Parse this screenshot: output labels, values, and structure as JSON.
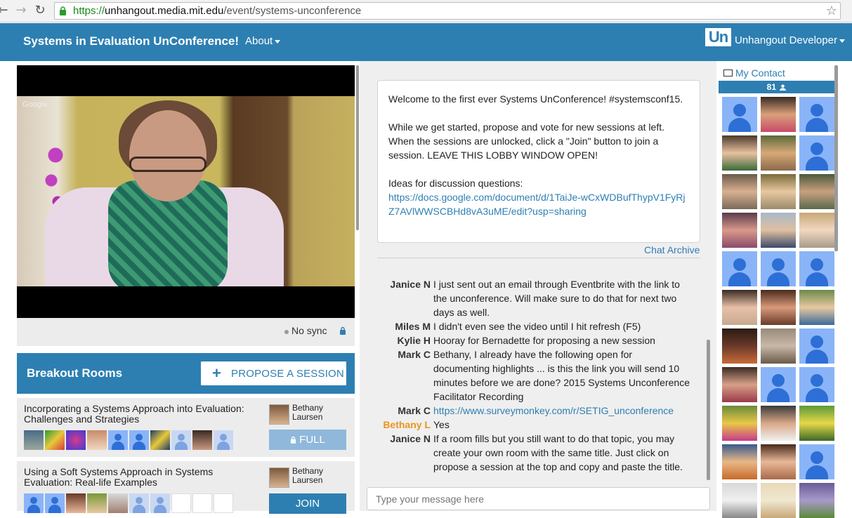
{
  "browser": {
    "url_scheme": "https://",
    "url_host": "unhangout.media.mit.edu",
    "url_path": "/event/systems-unconference"
  },
  "header": {
    "title": "Systems in Evaluation UnConference!",
    "about_label": "About",
    "logo_text": "Un",
    "user_label": "Unhangout Developer"
  },
  "video": {
    "watermark": "Google",
    "sync_label": "No sync"
  },
  "breakout": {
    "title": "Breakout Rooms",
    "propose_label": "PROPOSE A SESSION",
    "sessions": [
      {
        "title": "Incorporating a Systems Approach into Evaluation: Challenges and Strategies",
        "host": "Bethany Laursen",
        "button_label": "FULL"
      },
      {
        "title": "Using a Soft Systems Approach in Systems Evaluation: Real-life Examples",
        "host": "Bethany Laursen",
        "button_label": "JOIN"
      }
    ]
  },
  "welcome": {
    "line1": "Welcome to the first ever Systems UnConference! #systemsconf15.",
    "line2": "While we get started, propose and vote for new sessions at left. When the sessions are unlocked, click a \"Join\" button to join a session. LEAVE THIS LOBBY WINDOW OPEN!",
    "line3": "Ideas for discussion questions:",
    "link": "https://docs.google.com/document/d/1TaiJe-wCxWDBufThypV1FyRjZ7AVlWWSCBHd8vA3uME/edit?usp=sharing"
  },
  "chat": {
    "archive_label": "Chat Archive",
    "input_placeholder": "Type your message here",
    "messages": [
      {
        "who": "Janice N",
        "text": "I just sent out an email through Eventbrite with the link to the unconference. Will make sure to do that for next two days as well."
      },
      {
        "who": "Miles M",
        "text": "I didn't even see the video until I hit refresh (F5)"
      },
      {
        "who": "Kylie H",
        "text": "Hooray for Bernadette for proposing a new session"
      },
      {
        "who": "Mark C",
        "text": "Bethany, I already have the following open for documenting highlights ... is this the link you will send 10 minutes before we are done? 2015 Systems Unconference Facilitator Recording"
      },
      {
        "who": "Mark C",
        "text": "https://www.surveymonkey.com/r/SETIG_unconference"
      },
      {
        "who": "Bethany L",
        "text": "Yes"
      },
      {
        "who": "Janice N",
        "text": "If a room fills but you still want to do that topic, you may create your own room with the same title. Just click on propose a session at the top and copy and paste the title."
      }
    ]
  },
  "sidebar": {
    "contact_label": "My Contact",
    "participant_count": "81"
  },
  "colors": {
    "brand": "#2d7fb2",
    "highlight_user": "#e8951f",
    "placeholder_avatar": "#8ab4f8"
  }
}
